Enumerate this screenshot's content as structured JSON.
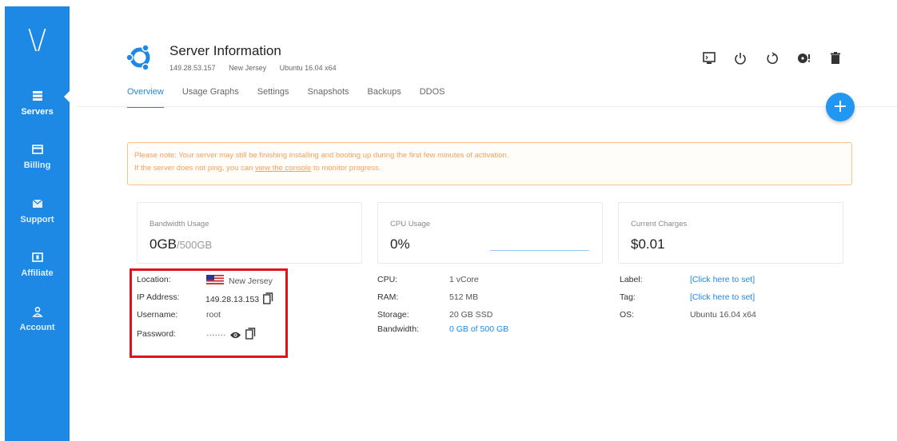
{
  "sidebar": {
    "logo": "\\/",
    "items": [
      {
        "label": "Servers",
        "icon": "servers-icon",
        "active": true
      },
      {
        "label": "Billing",
        "icon": "billing-icon"
      },
      {
        "label": "Support",
        "icon": "support-icon"
      },
      {
        "label": "Affiliate",
        "icon": "affiliate-icon"
      },
      {
        "label": "Account",
        "icon": "account-icon"
      }
    ],
    "color": "#1e88e5"
  },
  "header": {
    "title": "Server Information",
    "ip": "149.28.53.157",
    "location": "New Jersey",
    "os": "Ubuntu 16.04 x64",
    "logo_icon": "ubuntu-logo-icon"
  },
  "toolbar": {
    "icons": [
      "console-icon",
      "power-icon",
      "restart-icon",
      "reinstall-icon",
      "delete-icon"
    ]
  },
  "tabs": [
    {
      "label": "Overview",
      "active": true
    },
    {
      "label": "Usage Graphs"
    },
    {
      "label": "Settings"
    },
    {
      "label": "Snapshots"
    },
    {
      "label": "Backups"
    },
    {
      "label": "DDOS"
    }
  ],
  "fab": {
    "label": "+"
  },
  "notice": {
    "line1": "Please note: Your server may still be finishing installing and booting up during the first few minutes of activation.",
    "line2_pre": "If the server does not ping, you can ",
    "line2_link": "view the console",
    "line2_post": " to monitor progress."
  },
  "cards": {
    "bandwidth": {
      "label": "Bandwidth Usage",
      "value": "0GB",
      "total": "/500GB"
    },
    "cpu": {
      "label": "CPU Usage",
      "value": "0%"
    },
    "charges": {
      "label": "Current Charges",
      "value": "$0.01"
    }
  },
  "details_left": {
    "location_label": "Location:",
    "location_value": "New Jersey",
    "flag_icon": "us-flag-icon",
    "ip_label": "IP Address:",
    "ip_value": "149.28.13.153",
    "username_label": "Username:",
    "username_value": "root",
    "password_label": "Password:",
    "password_value": "·······"
  },
  "details_mid": {
    "cpu_label": "CPU:",
    "cpu_value": "1 vCore",
    "ram_label": "RAM:",
    "ram_value": "512 MB",
    "storage_label": "Storage:",
    "storage_value": "20 GB SSD",
    "bandwidth_label": "Bandwidth:",
    "bandwidth_value": "0 GB of 500 GB"
  },
  "details_right": {
    "label_label": "Label:",
    "label_value": "[Click here to set]",
    "tag_label": "Tag:",
    "tag_value": "[Click here to set]",
    "os_label": "OS:",
    "os_value": "Ubuntu 16.04 x64"
  },
  "colors": {
    "accent": "#1e88e5",
    "notice": "#f5a05b",
    "highlight": "#e0121b"
  }
}
